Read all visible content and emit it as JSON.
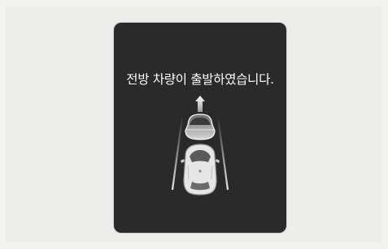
{
  "notification": {
    "message": "전방 차량이 출발하였습니다."
  },
  "icons": {
    "front_vehicle": "front-vehicle-icon",
    "departure_arrow": "up-arrow-icon",
    "own_vehicle": "own-vehicle-icon",
    "lanes": "lane-lines-icon"
  },
  "colors": {
    "page_background": "#ecedeb",
    "screen_background": "#2a2a2a",
    "text": "#ffffff",
    "car_body": "#e6e6e6"
  }
}
